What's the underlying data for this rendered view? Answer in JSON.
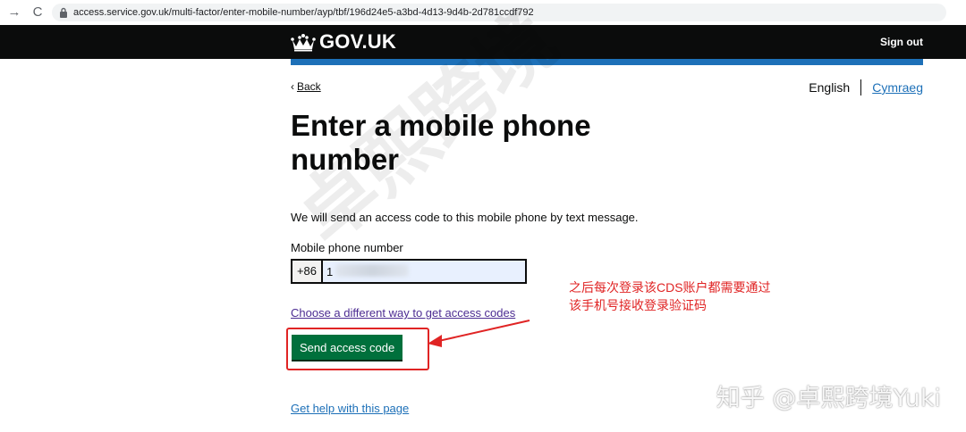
{
  "browser": {
    "url": "access.service.gov.uk/multi-factor/enter-mobile-number/ayp/tbf/196d24e5-a3bd-4d13-9d4b-2d781ccdf792",
    "back_icon": "→",
    "reload_icon": "C"
  },
  "header": {
    "logo_text": "GOV.UK",
    "sign_out": "Sign out"
  },
  "nav": {
    "back": "Back",
    "language": {
      "current": "English",
      "alternate": "Cymraeg"
    }
  },
  "main": {
    "title": "Enter a mobile phone number",
    "intro": "We will send an access code to this mobile phone by text message.",
    "phone_label": "Mobile phone number",
    "phone_prefix": "+86",
    "phone_value": "1",
    "alt_link": "Choose a different way to get access codes",
    "send_button": "Send access code",
    "help_link": "Get help with this page"
  },
  "annotation": {
    "note": "之后每次登录该CDS账户都需要通过\n该手机号接收登录验证码",
    "color": "#e02424"
  },
  "watermarks": {
    "diagonal": "卓熙跨境",
    "corner": "知乎 @卓熙跨境Yuki"
  },
  "colors": {
    "header_bg": "#0b0c0c",
    "accent_blue": "#1d70b8",
    "button_green": "#00703c",
    "visited_link": "#4c2c92"
  }
}
